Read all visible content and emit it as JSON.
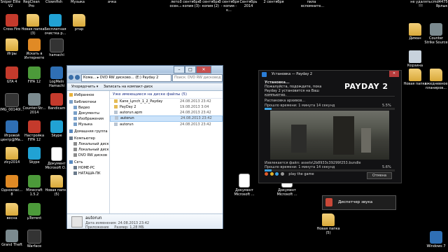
{
  "desktop": {
    "top_labels": [
      "Sniper Elite V2",
      "RegClean Pro",
      "Clownfish",
      "Музыка",
      "ачка",
      "лето-осен...",
      "3 сентября - копия (3)",
      "3 сентября - копия (2)",
      "3 сентября - копия - к...",
      "Сентябрь 2014",
      "2 сентября",
      "пила вспомните...",
      "не удалять !!!",
      "cmd4475621 Ярлык"
    ],
    "left_icons": [
      {
        "label": "Cross Fire",
        "icon": "crossfire-icon",
        "color": "red"
      },
      {
        "label": "Новая папка (3)",
        "icon": "folder-icon",
        "color": "folder"
      },
      {
        "label": "Бесплатная очистка р...",
        "icon": "cleaner-icon",
        "color": "cyan"
      },
      {
        "label": "pтар",
        "icon": "folder-icon",
        "color": "folder"
      },
      {
        "label": "Игры",
        "icon": "folder-icon",
        "color": "folder"
      },
      {
        "label": "Искать в Интернете",
        "icon": "search-web-icon",
        "color": "orange"
      },
      {
        "label": "hamachi",
        "icon": "hamachi-icon",
        "color": "dark"
      },
      {
        "label": "GTA 4",
        "icon": "gta4-icon",
        "color": "red"
      },
      {
        "label": "FIFA 12",
        "icon": "fifa12-icon",
        "color": "green"
      },
      {
        "label": "LogMeIn Hamachi",
        "icon": "hamachi-icon",
        "color": "blue"
      },
      {
        "label": "IMG_00140l...",
        "icon": "image-icon",
        "color": "dark"
      },
      {
        "label": "Counter-Str... 2014",
        "icon": "counter-strike-icon",
        "color": "grey"
      },
      {
        "label": "Bandicam",
        "icon": "bandicam-icon",
        "color": "red"
      },
      {
        "label": "Игровой центр@Ма...",
        "icon": "game-center-icon",
        "color": "blue"
      },
      {
        "label": "Настройка FIFA 12",
        "icon": "fifa12-settings-icon",
        "color": "red"
      },
      {
        "label": "Skype",
        "icon": "skype-icon",
        "color": "cyan"
      },
      {
        "label": "zlcy2014",
        "icon": "folder-icon",
        "color": "folder"
      },
      {
        "label": "Skype",
        "icon": "skype-icon",
        "color": "cyan"
      },
      {
        "label": "Документ Microsoft O...",
        "icon": "document-icon",
        "color": "doc"
      },
      {
        "label": "Одноклас... 8",
        "icon": "odnoklassniki-icon",
        "color": "orange"
      },
      {
        "label": "Minecraft 1.5.2",
        "icon": "minecraft-icon",
        "color": "green"
      },
      {
        "label": "Новая папка (5)",
        "icon": "folder-icon",
        "color": "folder"
      },
      {
        "label": "весна",
        "icon": "folder-icon",
        "color": "folder"
      },
      {
        "label": "µTorrent",
        "icon": "utorrent-icon",
        "color": "green"
      },
      {
        "label": "Grand Theft",
        "icon": "gta4-icon",
        "color": "grey"
      },
      {
        "label": "Warface",
        "icon": "warface-icon",
        "color": "dark"
      }
    ],
    "right_icons": [
      {
        "label": "Диман",
        "icon": "folder-icon",
        "color": "folder"
      },
      {
        "label": "Counter Strike Source",
        "icon": "counter-strike-icon",
        "color": "grey"
      },
      {
        "label": "Корзина",
        "icon": "recycle-bin-icon",
        "color": "bin"
      },
      {
        "label": "Новая папка",
        "icon": "folder-icon",
        "color": "folder"
      },
      {
        "label": "ежедневное планиров...",
        "icon": "folder-icon",
        "color": "folder"
      },
      {
        "label": "Windows 7",
        "icon": "windows-icon",
        "color": "blue"
      }
    ],
    "middle_icons": [
      {
        "label": "Документ Microsoft ...",
        "icon": "document-icon",
        "color": "doc"
      },
      {
        "label": "Документ Microsoft ...",
        "icon": "document-icon",
        "color": "doc"
      },
      {
        "label": "Новая папка (5)",
        "icon": "folder-icon",
        "color": "folder"
      }
    ]
  },
  "explorer": {
    "path": "Кома... ▸ DVD RW дисково... (E:) Payday 2",
    "search_placeholder": "Поиск: DVD RW дисковод (E:) Pa...",
    "toolbar": {
      "organize": "Упорядочить ▾",
      "burn": "Записать на компакт-диск"
    },
    "nav": [
      {
        "label": "Избранное",
        "icon": "star-icon"
      },
      {
        "label": "Библиотеки",
        "icon": "library-icon"
      },
      {
        "label": "Видео",
        "icon": "video-icon"
      },
      {
        "label": "Документы",
        "icon": "documents-icon"
      },
      {
        "label": "Изображения",
        "icon": "images-icon"
      },
      {
        "label": "Музыка",
        "icon": "music-icon"
      },
      {
        "label": "Домашняя группа",
        "icon": "homegroup-icon"
      },
      {
        "label": "Компьютер",
        "icon": "computer-icon"
      },
      {
        "label": "Локальный диск",
        "icon": "drive-icon"
      },
      {
        "label": "Локальный диск",
        "icon": "drive-icon"
      },
      {
        "label": "DVD RW дисков",
        "icon": "dvd-icon"
      },
      {
        "label": "Сеть",
        "icon": "network-icon"
      },
      {
        "label": "HOME-PC",
        "icon": "pc-icon"
      },
      {
        "label": "НАТАША-ПК",
        "icon": "pc-icon"
      }
    ],
    "group_header": "Уже имеющиеся на диске файлы (5)",
    "files": [
      {
        "name": "Kane_Lynch_1_2_Payday",
        "date": "24.08.2013 23:42",
        "selected": false
      },
      {
        "name": "PayDay 2",
        "date": "19.08.2013 3:04",
        "selected": false
      },
      {
        "name": "autorun.apm",
        "date": "24.08.2013 23:42",
        "selected": false
      },
      {
        "name": "autorun",
        "date": "24.08.2013 23:42",
        "selected": true
      },
      {
        "name": "autorun",
        "date": "24.08.2013 23:42",
        "selected": false
      }
    ],
    "details": {
      "name": "autorun",
      "modified": "Дата изменения: 24.08.2013 23:42",
      "size": "Размер: 1,28 МБ",
      "type": "Приложение"
    }
  },
  "installer": {
    "title": "Установка — Payday 2",
    "heading": "Установка...",
    "message": "Пожалуйста, подождите, пока Payday 2 установится на Ваш компьютер.",
    "logo": "PAYDAY 2",
    "unpacking_label": "Распаковка архивов...",
    "progress1_label": "Прошло времени: 1 минута 14 секунд",
    "progress1_value": "5.5%",
    "progress1_fraction": 0.055,
    "extracting_label": "Извлекается файл: assets\\2b8933c39299f253.bundle",
    "progress2_label": "Прошло времени: 1 минута 14 секунд",
    "progress2_value": "5.6%",
    "progress2_fraction": 0.056,
    "play_label": "play the game",
    "cancel_label": "Отмена"
  },
  "sound_popup": {
    "label": "Диспетчер звука"
  }
}
